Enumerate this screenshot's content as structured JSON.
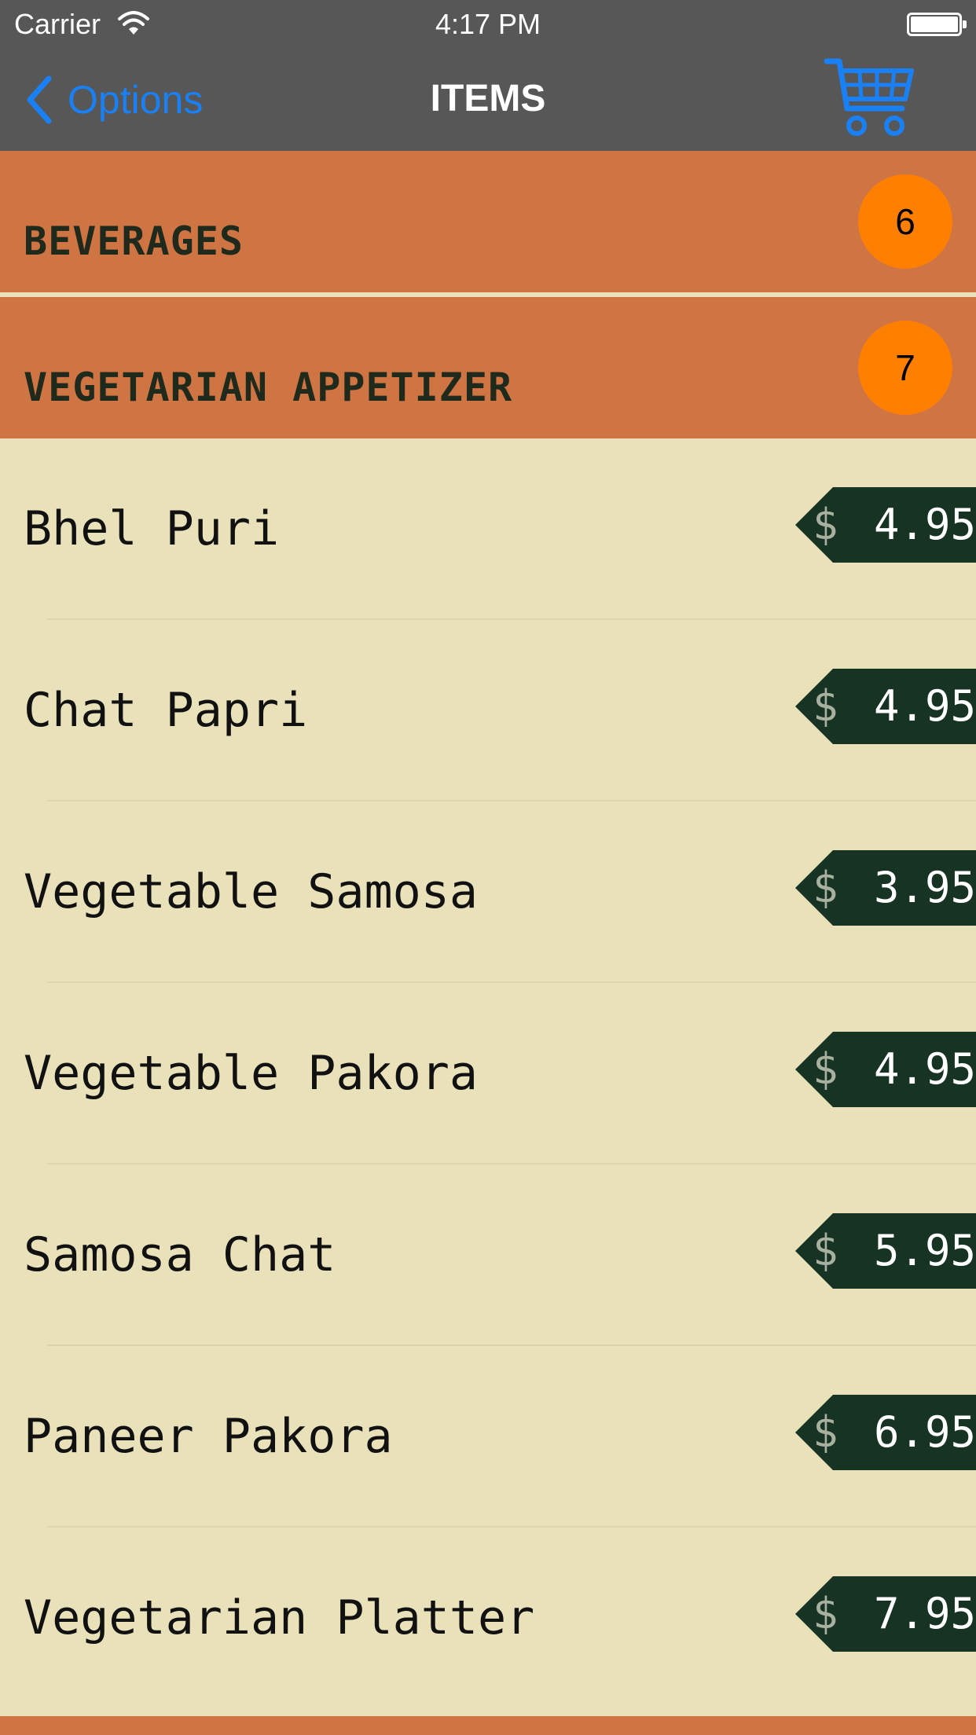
{
  "status_bar": {
    "carrier": "Carrier",
    "time": "4:17 PM",
    "icons": [
      "wifi-icon",
      "battery-icon"
    ]
  },
  "nav": {
    "back_label": "Options",
    "title": "ITEMS",
    "cart_icon": "cart-icon",
    "accent_color": "#1a80f5"
  },
  "categories": [
    {
      "name": "BEVERAGES",
      "count": "6"
    },
    {
      "name": "VEGETARIAN APPETIZER",
      "count": "7"
    }
  ],
  "items": [
    {
      "name": "Bhel Puri",
      "currency": "$",
      "price": "4.95"
    },
    {
      "name": "Chat Papri",
      "currency": "$",
      "price": "4.95"
    },
    {
      "name": "Vegetable Samosa",
      "currency": "$",
      "price": "3.95"
    },
    {
      "name": "Vegetable Pakora",
      "currency": "$",
      "price": "4.95"
    },
    {
      "name": "Samosa Chat",
      "currency": "$",
      "price": "5.95"
    },
    {
      "name": "Paneer Pakora",
      "currency": "$",
      "price": "6.95"
    },
    {
      "name": "Vegetarian Platter",
      "currency": "$",
      "price": "7.95"
    }
  ],
  "colors": {
    "nav_bg": "#575757",
    "category_bg": "#cf7443",
    "badge_bg": "#ff7f00",
    "list_bg": "#e9e1b9",
    "price_tag_bg": "#173324"
  }
}
